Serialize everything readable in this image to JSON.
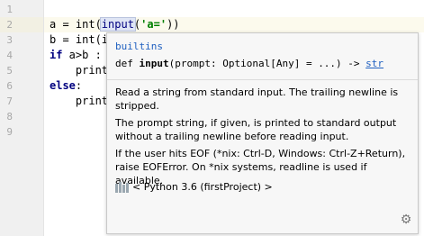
{
  "editor": {
    "line_numbers": [
      "1",
      "2",
      "3",
      "4",
      "5",
      "6",
      "7",
      "8",
      "9"
    ],
    "lines": {
      "l2_pre": "a = int(",
      "l2_call": "input",
      "l2_paren": "(",
      "l2_str": "'a='",
      "l2_post": "))",
      "l3_pre": "b = int(",
      "l3_partial": "i",
      "l4_kw": "if",
      "l4_rest": " a>b :",
      "l5": "    print",
      "l6_kw": "else",
      "l6_rest": ":",
      "l7": "    print"
    }
  },
  "quickdoc": {
    "module": "builtins",
    "sig_def": "def ",
    "sig_name": "input",
    "sig_params": "(prompt: Optional[Any] = ...) -> ",
    "sig_return": "str",
    "paragraphs": [
      "Read a string from standard input. The trailing newline is stripped.",
      "The prompt string, if given, is printed to standard output without a trailing newline before reading input.",
      "If the user hits EOF (*nix: Ctrl-D, Windows: Ctrl-Z+Return), raise EOFError. On *nix systems, readline is used if available."
    ],
    "sdk": "< Python 3.6 (firstProject) >"
  }
}
